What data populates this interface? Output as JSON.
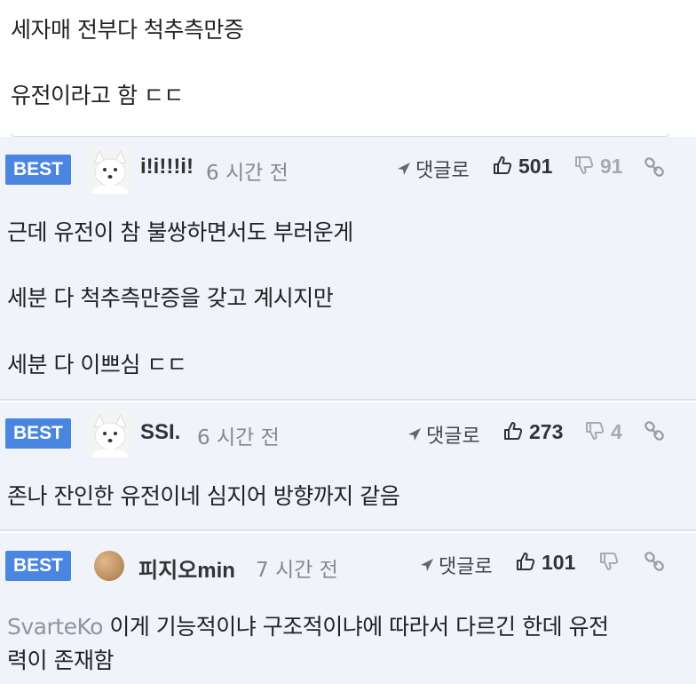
{
  "post": {
    "lines": [
      "세자매 전부다 척추측만증",
      "유전이라고 함 ㄷㄷ"
    ]
  },
  "labels": {
    "best": "BEST",
    "reply": "댓글로"
  },
  "comments": [
    {
      "nickname": "i!i!!!i!",
      "time": "6 시간 전",
      "upvotes": "501",
      "downvotes": "91",
      "lines": [
        "근데 유전이 참 불쌍하면서도 부러운게",
        "세분 다 척추측만증을 갖고 계시지만",
        "세분 다 이쁘심 ㄷㄷ"
      ]
    },
    {
      "nickname": "SSI.",
      "time": "6 시간 전",
      "upvotes": "273",
      "downvotes": "4",
      "lines": [
        "존나 잔인한 유전이네 심지어 방향까지 같음"
      ]
    },
    {
      "nickname": "피지오min",
      "time": "7 시간 전",
      "upvotes": "101",
      "downvotes": "",
      "reply_to": "SvarteKo",
      "lines": [
        " 이게 기능적이냐 구조적이냐에 따라서 다르긴 한데 유전",
        "력이 존재함"
      ]
    }
  ],
  "colors": {
    "best_badge": "#4a86e0",
    "comment_bg": "#f0f3fa"
  }
}
